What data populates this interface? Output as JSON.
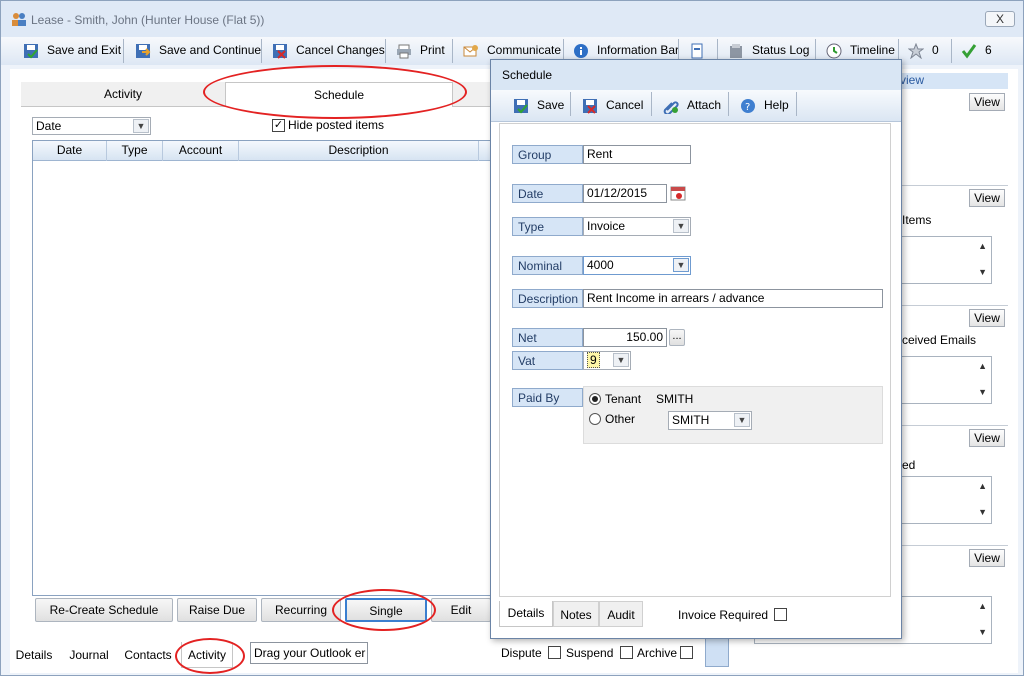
{
  "window": {
    "title": "Lease - Smith, John (Hunter House (Flat 5))",
    "close_label": "X"
  },
  "toolbar": {
    "save_exit": "Save and Exit",
    "save_continue": "Save and Continue",
    "cancel_changes": "Cancel Changes",
    "print": "Print",
    "communicate": "Communicate",
    "information_bar": "Information Bar",
    "status_log": "Status Log",
    "timeline": "Timeline",
    "star_count": "0",
    "check_count": "6"
  },
  "top_tabs": {
    "activity": "Activity",
    "schedule": "Schedule"
  },
  "filter": {
    "sort_value": "Date",
    "hide_posted_label": "Hide posted items",
    "hide_posted_checked": true
  },
  "grid": {
    "columns": [
      "Date",
      "Type",
      "Account",
      "Description"
    ]
  },
  "action_buttons": {
    "recreate": "Re-Create Schedule",
    "raise_due": "Raise Due",
    "recurring": "Recurring",
    "single": "Single",
    "edit": "Edit"
  },
  "bottom_tabs": {
    "details": "Details",
    "journal": "Journal",
    "contacts": "Contacts",
    "activity": "Activity",
    "outlook_placeholder": "Drag your Outlook er"
  },
  "status_checks": {
    "dispute": "Dispute",
    "suspend": "Suspend",
    "archive": "Archive"
  },
  "dialog": {
    "title": "Schedule",
    "toolbar": {
      "save": "Save",
      "cancel": "Cancel",
      "attach": "Attach",
      "help": "Help"
    },
    "fields": {
      "group_label": "Group",
      "group_value": "Rent",
      "date_label": "Date",
      "date_value": "01/12/2015",
      "type_label": "Type",
      "type_value": "Invoice",
      "nominal_label": "Nominal",
      "nominal_value": "4000",
      "description_label": "Description",
      "description_value": "Rent Income in arrears / advance",
      "net_label": "Net",
      "net_value": "150.00",
      "net_button": "...",
      "vat_label": "Vat",
      "vat_value": "9",
      "paid_by_label": "Paid By",
      "tenant_label": "Tenant",
      "tenant_name": "SMITH",
      "other_label": "Other",
      "other_value": "SMITH"
    },
    "tabs": {
      "details": "Details",
      "notes": "Notes",
      "audit": "Audit"
    },
    "invoice_required_label": "Invoice Required"
  },
  "right_panel": {
    "header_fragment": "view",
    "view_label": "View",
    "fragment_items": "Items",
    "fragment_emails": "ceived Emails",
    "fragment_ed": "ed"
  },
  "colors": {
    "accent": "#3a6fb0",
    "annotation_red": "#e32222",
    "label_bg": "#d6e5f6"
  }
}
